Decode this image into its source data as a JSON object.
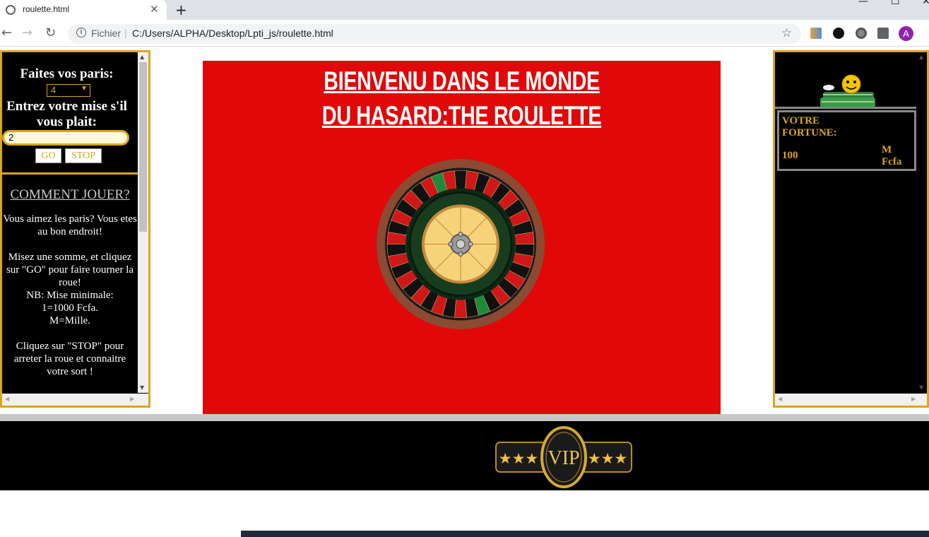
{
  "browser": {
    "tab_title": "roulette.html",
    "tab_close": "✕",
    "new_tab": "+",
    "nav_back": "←",
    "nav_forward": "→",
    "nav_reload": "↻",
    "scheme_label": "Fichier",
    "url": "C:/Users/ALPHA/Desktop/Lpti_js/roulette.html",
    "bookmark_star": "☆",
    "avatar_letter": "A",
    "win_minimize": "—",
    "win_maximize": "☐",
    "win_close": "✕"
  },
  "left_panel": {
    "bets_label": "Faites vos paris:",
    "bet_selected": "4",
    "stake_label": "Entrez votre mise s'il vous plait:",
    "stake_value": "2",
    "go_label": "GO",
    "stop_label": "STOP",
    "howto_title": "COMMENT JOUER?",
    "howto_text": "Vous aimez les paris? Vous etes au bon endroit!\n\nMisez une somme, et cliquez sur \"GO\" pour faire tourner la roue!\nNB: Mise minimale:\n1=1000 Fcfa.\nM=Mille.\n\nCliquez sur \"STOP\" pour arreter la roue et connaitre votre sort !"
  },
  "main": {
    "title_line1": "BIENVENU DANS LE MONDE",
    "title_line2": "DU HASARD:THE ROULETTE",
    "wheel_icon": "roulette-wheel-icon"
  },
  "right_panel": {
    "fortune_label": "VOTRE FORTUNE:",
    "fortune_value": "100",
    "fortune_unit": "M Fcfa"
  },
  "bottom": {
    "vip_label": "VIP",
    "stars_left": "★★★",
    "stars_right": "★★★"
  },
  "colors": {
    "gold": "#daa520",
    "red_panel": "#e00808",
    "frame_bg": "#000000"
  }
}
